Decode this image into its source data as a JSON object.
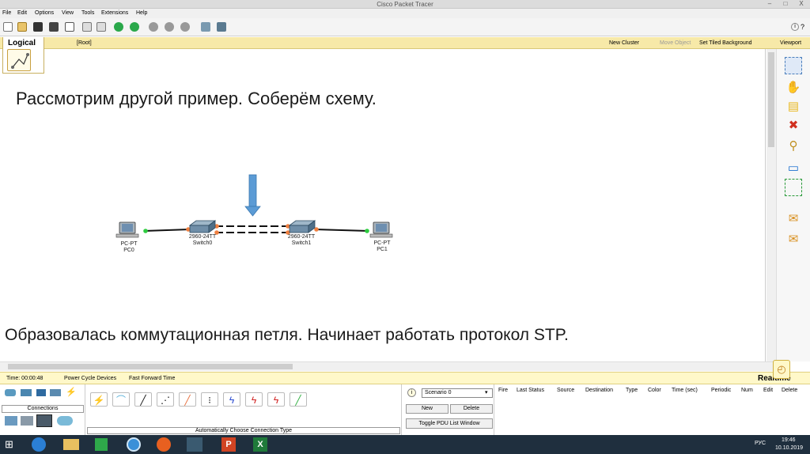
{
  "window": {
    "title": "Cisco Packet Tracer",
    "minimize": "–",
    "maximize": "□",
    "close": "X"
  },
  "menu": [
    "File",
    "Edit",
    "Options",
    "View",
    "Tools",
    "Extensions",
    "Help"
  ],
  "workspace_bar": {
    "tab": "Logical",
    "root": "[Root]",
    "new_cluster": "New Cluster",
    "move_object": "Move Object",
    "set_tiled_background": "Set Tiled Background",
    "viewport": "Viewport"
  },
  "slide": {
    "heading": "Рассмотрим другой пример. Соберём схему.",
    "caption": "Образовалась коммутационная петля. Начинает работать протокол STP."
  },
  "devices": {
    "pc0": {
      "model": "PC-PT",
      "name": "PC0"
    },
    "switch0": {
      "model": "2960-24TT",
      "name": "Switch0"
    },
    "switch1": {
      "model": "2960-24TT",
      "name": "Switch1"
    },
    "pc1": {
      "model": "PC-PT",
      "name": "PC1"
    }
  },
  "realtime_bar": {
    "time": "Time: 00:00:48",
    "power_cycle": "Power Cycle Devices",
    "fast_forward": "Fast Forward Time",
    "mode": "Realtime"
  },
  "device_panel": {
    "category": "Connections",
    "subcategory_label": "Automatically Choose Connection Type"
  },
  "scenario": {
    "selected": "Scenario 0",
    "new": "New",
    "delete": "Delete",
    "toggle": "Toggle PDU List Window"
  },
  "pdu_columns": [
    "Fire",
    "Last Status",
    "Source",
    "Destination",
    "Type",
    "Color",
    "Time (sec)",
    "Periodic",
    "Num",
    "Edit",
    "Delete"
  ],
  "tray": {
    "lang": "РУС",
    "time": "19:46",
    "date": "10.10.2019"
  },
  "colors": {
    "workbar": "#f7e9a8",
    "realtime_bar": "#fff8c9",
    "arrow": "#5b9bd5",
    "taskbar": "#1f2f3e",
    "link_port": "#2ecc40",
    "switch_port": "#f08040"
  }
}
